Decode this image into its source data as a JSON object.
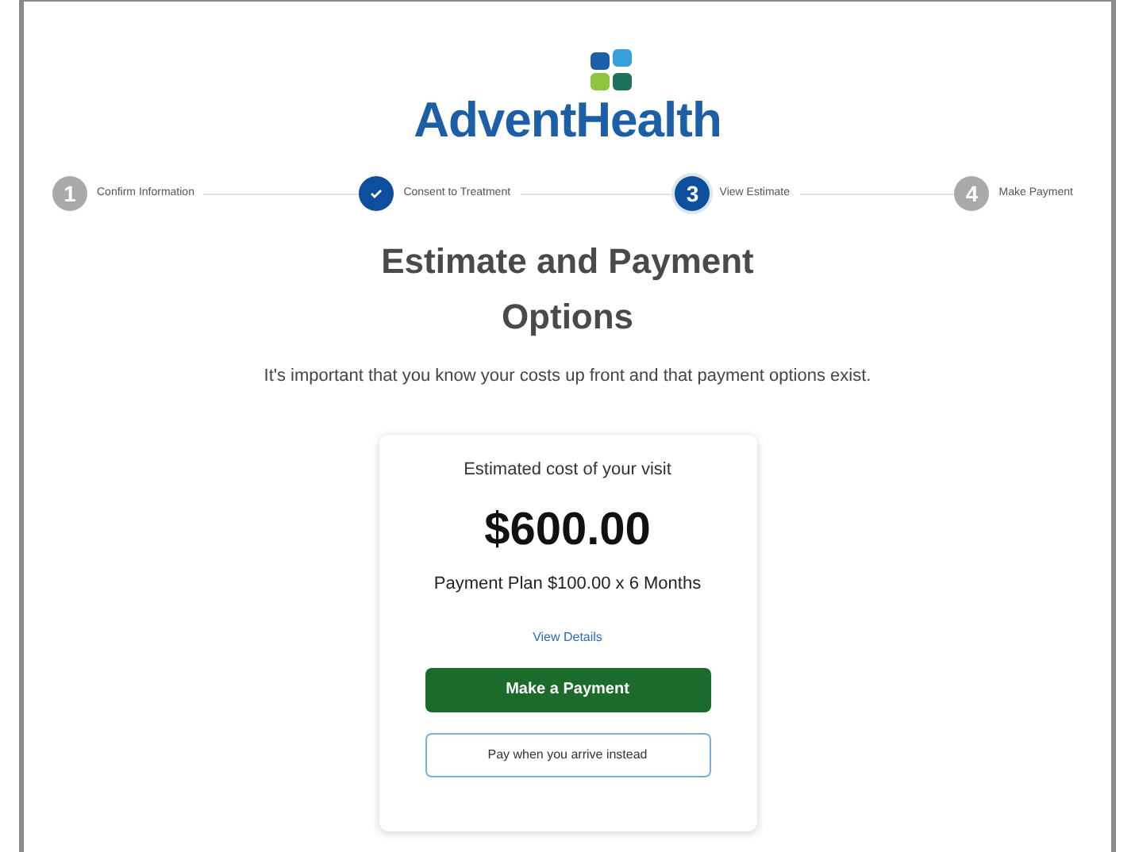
{
  "logo": {
    "text": "AdventHealth"
  },
  "steps": [
    {
      "number": "1",
      "label": "Confirm Information",
      "completed": false,
      "selected": false
    },
    {
      "label": "Consent to Treatment",
      "completed": true,
      "selected": false
    },
    {
      "number": "3",
      "label": "View Estimate",
      "completed": false,
      "selected": true
    },
    {
      "number": "4",
      "label": "Make Payment",
      "completed": false,
      "selected": false
    }
  ],
  "title": "Estimate and Payment Options",
  "subtitle": "It's important that you know your costs up front and that payment options exist.",
  "card": {
    "heading": "Estimated cost of your visit",
    "amount": "$600.00",
    "plan": "Payment Plan $100.00 x 6 Months",
    "details_link": "View Details",
    "primary_button": "Make a Payment",
    "secondary_button": "Pay when you arrive instead"
  }
}
